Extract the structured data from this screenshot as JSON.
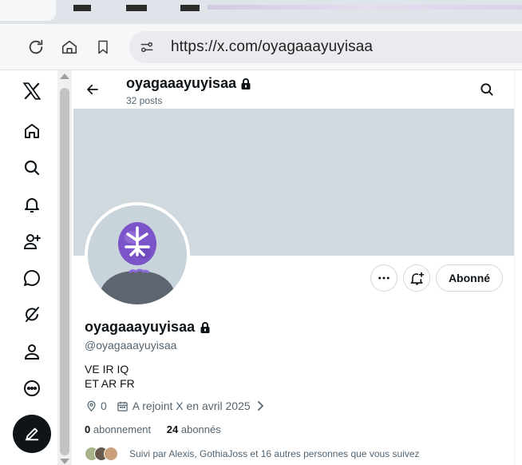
{
  "browser": {
    "url": "https://x.com/oyagaaayuyisaa",
    "icons": [
      "reload-icon",
      "home-icon",
      "bookmark-icon",
      "site-settings-icon"
    ]
  },
  "nav": {
    "icons": [
      "x-logo-icon",
      "home-icon",
      "search-icon",
      "notifications-icon",
      "follow-icon",
      "messages-icon",
      "grok-icon",
      "profile-icon",
      "more-icon",
      "compose-icon"
    ]
  },
  "header": {
    "name": "oyagaaayuyisaa",
    "posts": "32 posts"
  },
  "profile": {
    "name": "oyagaaayuyisaa",
    "handle": "@oyagaaayuyisaa",
    "bio_line1": "VE IR IQ",
    "bio_line2": "ET AR FR",
    "location": "0",
    "joined": "A rejoint X en avril 2025",
    "following_count": "0",
    "following_label": "abonnement",
    "followers_count": "24",
    "followers_label": "abonnés",
    "followed_by": "Suivi par Alexis, GothiaJoss et 16 autres personnes que vous suivez",
    "follow_button": "Abonné"
  },
  "colors": {
    "banner": "#cfd9de",
    "text_primary": "#0f1419",
    "text_secondary": "#536471",
    "avatar_purple": "#7b54c9"
  }
}
